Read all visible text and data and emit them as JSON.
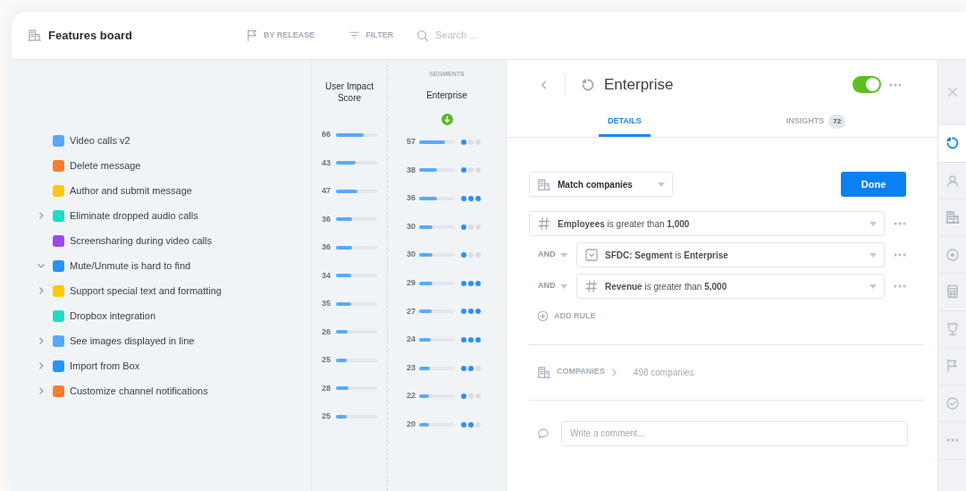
{
  "header": {
    "title": "Features board",
    "group_by": "BY RELEASE",
    "filter": "FILTER",
    "search": {
      "placeholder": "Search ..."
    }
  },
  "features": [
    {
      "name": "Video calls v2",
      "color": "#56a8fb",
      "expandable": false
    },
    {
      "name": "Delete message",
      "color": "#fb7d2f",
      "expandable": false
    },
    {
      "name": "Author and submit message",
      "color": "#fdc90a",
      "expandable": false
    },
    {
      "name": "Eliminate dropped audio calls",
      "color": "#1fdcc6",
      "expandable": true,
      "expanded": false
    },
    {
      "name": "Screensharing during video calls",
      "color": "#9d47f0",
      "expandable": false
    },
    {
      "name": "Mute/Unmute is hard to find",
      "color": "#2793fb",
      "expandable": true,
      "expanded": true
    },
    {
      "name": "Support special text and formatting",
      "color": "#fdc90a",
      "expandable": true,
      "expanded": false
    },
    {
      "name": "Dropbox integration",
      "color": "#1fdcc6",
      "expandable": false
    },
    {
      "name": "See images displayed in line",
      "color": "#56a8fb",
      "expandable": true,
      "expanded": false
    },
    {
      "name": "Import from Box",
      "color": "#2793fb",
      "expandable": true,
      "expanded": false
    },
    {
      "name": "Customize channel notifications",
      "color": "#fb7d2f",
      "expandable": true,
      "expanded": false
    }
  ],
  "score_column": {
    "title": "User Impact Score",
    "rows": [
      {
        "value": "66",
        "level": 0.68
      },
      {
        "value": "43",
        "level": 0.48
      },
      {
        "value": "47",
        "level": 0.52
      },
      {
        "value": "36",
        "level": 0.4
      },
      {
        "value": "36",
        "level": 0.4
      },
      {
        "value": "34",
        "level": 0.37
      },
      {
        "value": "35",
        "level": 0.38
      },
      {
        "value": "26",
        "level": 0.28
      },
      {
        "value": "25",
        "level": 0.27
      },
      {
        "value": "28",
        "level": 0.31
      },
      {
        "value": "25",
        "level": 0.27
      }
    ]
  },
  "segment_column": {
    "group": "SEGMENTS",
    "title": "Enterprise",
    "rows": [
      {
        "value": "57",
        "level": 0.73,
        "stars": 1
      },
      {
        "value": "38",
        "level": 0.5,
        "stars": 1
      },
      {
        "value": "36",
        "level": 0.5,
        "stars": 3
      },
      {
        "value": "30",
        "level": 0.38,
        "stars": 1
      },
      {
        "value": "30",
        "level": 0.38,
        "stars": 1
      },
      {
        "value": "29",
        "level": 0.38,
        "stars": 3
      },
      {
        "value": "27",
        "level": 0.35,
        "stars": 3
      },
      {
        "value": "24",
        "level": 0.32,
        "stars": 3
      },
      {
        "value": "23",
        "level": 0.3,
        "stars": 2
      },
      {
        "value": "22",
        "level": 0.28,
        "stars": 1
      },
      {
        "value": "20",
        "level": 0.27,
        "stars": 2
      }
    ]
  },
  "detail_panel": {
    "title": "Enterprise",
    "enabled": true,
    "tabs": [
      {
        "label": "DETAILS",
        "selected": true
      },
      {
        "label": "INSIGHTS",
        "badge": "72",
        "selected": false
      }
    ],
    "match_select": "Match companies",
    "done_button": "Done",
    "rules": [
      {
        "kind": "number",
        "text": "**Employees** is greater than **1,000**"
      },
      {
        "kind": "picklist",
        "connector": "AND",
        "text": "**SFDC: Segment** is **Enterprise**"
      },
      {
        "kind": "number",
        "connector": "AND",
        "text": "**Revenue** is greater than **5,000**"
      }
    ],
    "add_rule": "ADD RULE",
    "companies_link": "COMPANIES",
    "companies_count": "498 companies",
    "comment": {
      "placeholder": "Write a comment..."
    }
  },
  "rail": [
    {
      "kind": "segments",
      "selected": true
    },
    {
      "kind": "person",
      "selected": false
    },
    {
      "kind": "building",
      "selected": false
    },
    {
      "kind": "target",
      "selected": false
    },
    {
      "kind": "calculator",
      "selected": false
    },
    {
      "kind": "trophy",
      "selected": false
    },
    {
      "kind": "flag",
      "selected": false
    },
    {
      "kind": "check",
      "selected": false
    },
    {
      "kind": "more",
      "selected": false
    }
  ]
}
